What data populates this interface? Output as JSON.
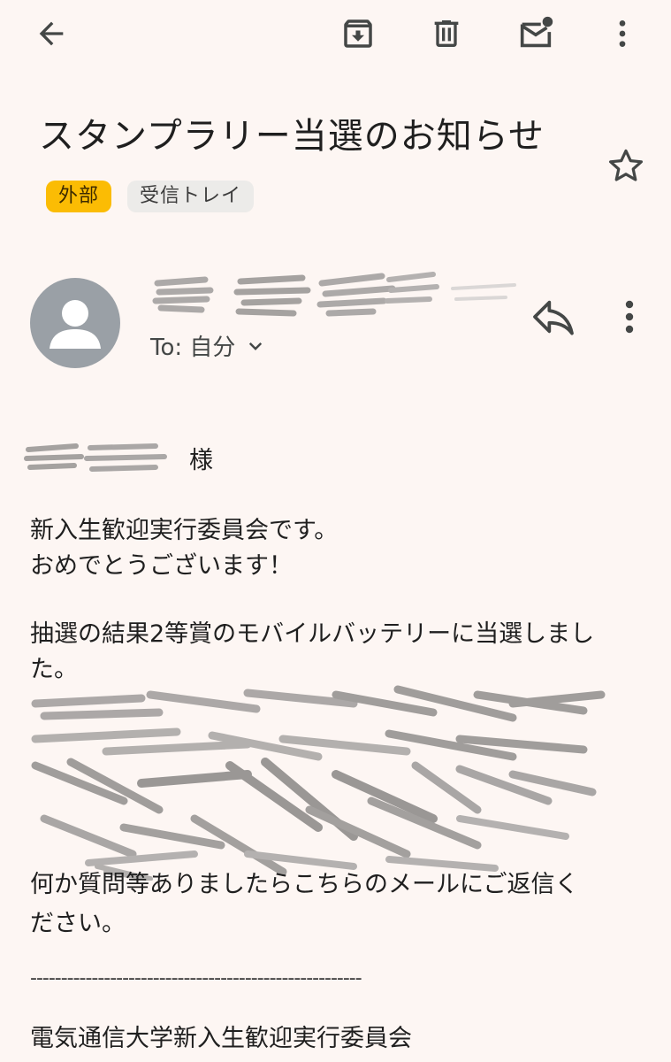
{
  "toolbar": {
    "back_icon": "arrow-back-icon",
    "archive_icon": "archive-icon",
    "delete_icon": "trash-icon",
    "mark_unread_icon": "mark-unread-icon",
    "more_icon": "more-vert-icon"
  },
  "email": {
    "subject": "スタンプラリー当選のお知らせ",
    "labels": {
      "external": "外部",
      "inbox": "受信トレイ"
    },
    "starred": false,
    "to_line": "To: 自分",
    "greeting_suffix": "様",
    "body": {
      "line1": "新入生歓迎実行委員会です。",
      "line2": "おめでとうございます！",
      "line3": "抽選の結果2等賞のモバイルバッテリーに当選しまし",
      "line4": "た。",
      "line5": "何か質問等ありましたらこちらのメールにご返信く",
      "line6": "ださい。",
      "divider": "------------------------------------------------------",
      "signature": "電気通信大学新入生歓迎実行委員会"
    }
  },
  "colors": {
    "background": "#fdf6f3",
    "external_chip": "#fbbc04",
    "inbox_chip": "#ecebe9",
    "avatar": "#9aa0a6",
    "icon": "#444746"
  }
}
